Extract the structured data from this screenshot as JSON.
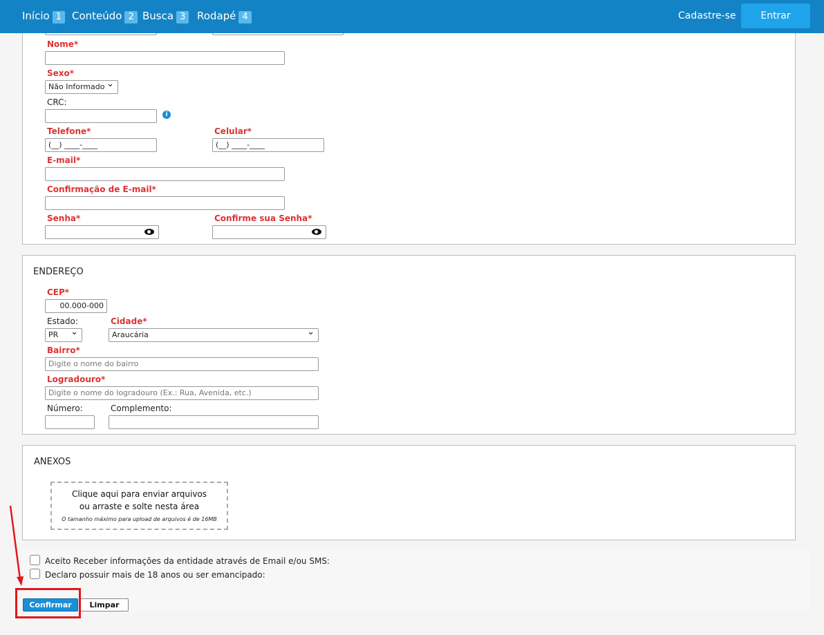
{
  "nav": {
    "items": [
      {
        "label": "Início",
        "badge": "1"
      },
      {
        "label": "Conteúdo",
        "badge": "2"
      },
      {
        "label": "Busca",
        "badge": "3"
      },
      {
        "label": "Rodapé",
        "badge": "4"
      }
    ],
    "register_label": "Cadastre-se",
    "login_label": "Entrar"
  },
  "personal": {
    "nome_label": "Nome*",
    "sexo_label": "Sexo*",
    "sexo_value": "Não Informado",
    "crc_label": "CRC:",
    "telefone_label": "Telefone*",
    "telefone_mask": "(__) ____-____",
    "celular_label": "Celular*",
    "celular_mask": "(__) ____-____",
    "email_label": "E-mail*",
    "email_confirm_label": "Confirmação de E-mail*",
    "senha_label": "Senha*",
    "senha_confirm_label": "Confirme sua Senha*"
  },
  "address": {
    "title": "ENDEREÇO",
    "cep_label": "CEP*",
    "cep_value": "00.000-000",
    "estado_label": "Estado:",
    "estado_value": "PR",
    "cidade_label": "Cidade*",
    "cidade_value": "Araucária",
    "bairro_label": "Bairro*",
    "bairro_placeholder": "Digite o nome do bairro",
    "logradouro_label": "Logradouro*",
    "logradouro_placeholder": "Digite o nome do logradouro (Ex.: Rua, Avenida, etc.)",
    "numero_label": "Número:",
    "complemento_label": "Complemento:"
  },
  "attachments": {
    "title": "ANEXOS",
    "line1": "Clique aqui para enviar arquivos",
    "line2": "ou arraste e solte nesta área",
    "note": "O tamanho máximo para upload de arquivos é de 16MB"
  },
  "consents": {
    "email_sms": "Aceito Receber informações da entidade através de Email e/ou SMS:",
    "age": "Declaro possuir mais de 18 anos ou ser emancipado:"
  },
  "actions": {
    "confirm_label": "Confirmar",
    "clear_label": "Limpar"
  },
  "colors": {
    "header": "#1383c5",
    "required": "#d33333",
    "annotation": "#e0171e"
  }
}
